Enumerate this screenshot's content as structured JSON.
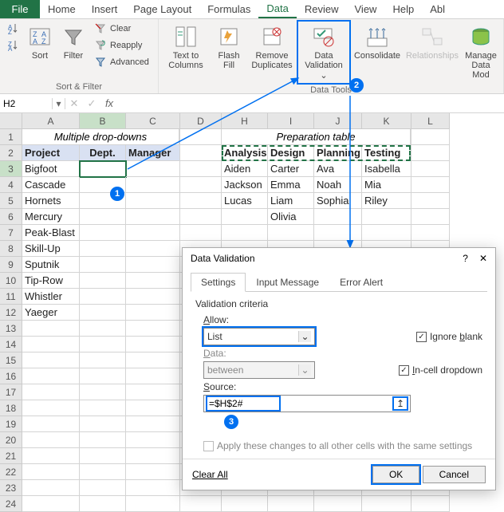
{
  "tabs": {
    "file": "File",
    "home": "Home",
    "insert": "Insert",
    "pagelayout": "Page Layout",
    "formulas": "Formulas",
    "data": "Data",
    "review": "Review",
    "view": "View",
    "help": "Help",
    "abl": "Abl"
  },
  "ribbon": {
    "sort": "Sort",
    "filter": "Filter",
    "clear": "Clear",
    "reapply": "Reapply",
    "advanced": "Advanced",
    "texttocols": "Text to Columns",
    "flashfill": "Flash Fill",
    "removedup": "Remove Duplicates",
    "datavalidation": "Data Validation",
    "datavalidation_dd": "⌄",
    "consolidate": "Consolidate",
    "relationships": "Relationships",
    "managedm": "Manage Data Mod",
    "group_sort": "Sort & Filter",
    "group_datatools": "Data Tools"
  },
  "namebox": "H2",
  "columns": [
    "A",
    "B",
    "C",
    "D",
    "H",
    "I",
    "J",
    "K",
    "L"
  ],
  "rows_visible": 24,
  "grid": {
    "title_left": "Multiple drop-downs",
    "title_right": "Preparation table",
    "headers_left": [
      "Project",
      "Dept.",
      "Manager"
    ],
    "headers_right": [
      "Analysis",
      "Design",
      "Planning",
      "Testing"
    ],
    "projects": [
      "Bigfoot",
      "Cascade",
      "Hornets",
      "Mercury",
      "Peak-Blast",
      "Skill-Up",
      "Sputnik",
      "Tip-Row",
      "Whistler",
      "Yaeger"
    ],
    "prep": {
      "Analysis": [
        "Aiden",
        "Jackson",
        "Lucas"
      ],
      "Design": [
        "Carter",
        "Emma",
        "Liam",
        "Olivia"
      ],
      "Planning": [
        "Ava",
        "Noah",
        "Sophia"
      ],
      "Testing": [
        "Isabella",
        "Mia",
        "Riley"
      ]
    }
  },
  "dialog": {
    "title": "Data Validation",
    "tabs": [
      "Settings",
      "Input Message",
      "Error Alert"
    ],
    "criteria_label": "Validation criteria",
    "allow_label": "Allow:",
    "allow_value": "List",
    "data_label": "Data:",
    "data_value": "between",
    "source_label": "Source:",
    "source_value": "=$H$2#",
    "ignore_blank": "Ignore blank",
    "incell_dd": "In-cell dropdown",
    "apply_all": "Apply these changes to all other cells with the same settings",
    "clear_all": "Clear All",
    "ok": "OK",
    "cancel": "Cancel"
  },
  "callouts": {
    "c1": "1",
    "c2": "2",
    "c3": "3"
  }
}
